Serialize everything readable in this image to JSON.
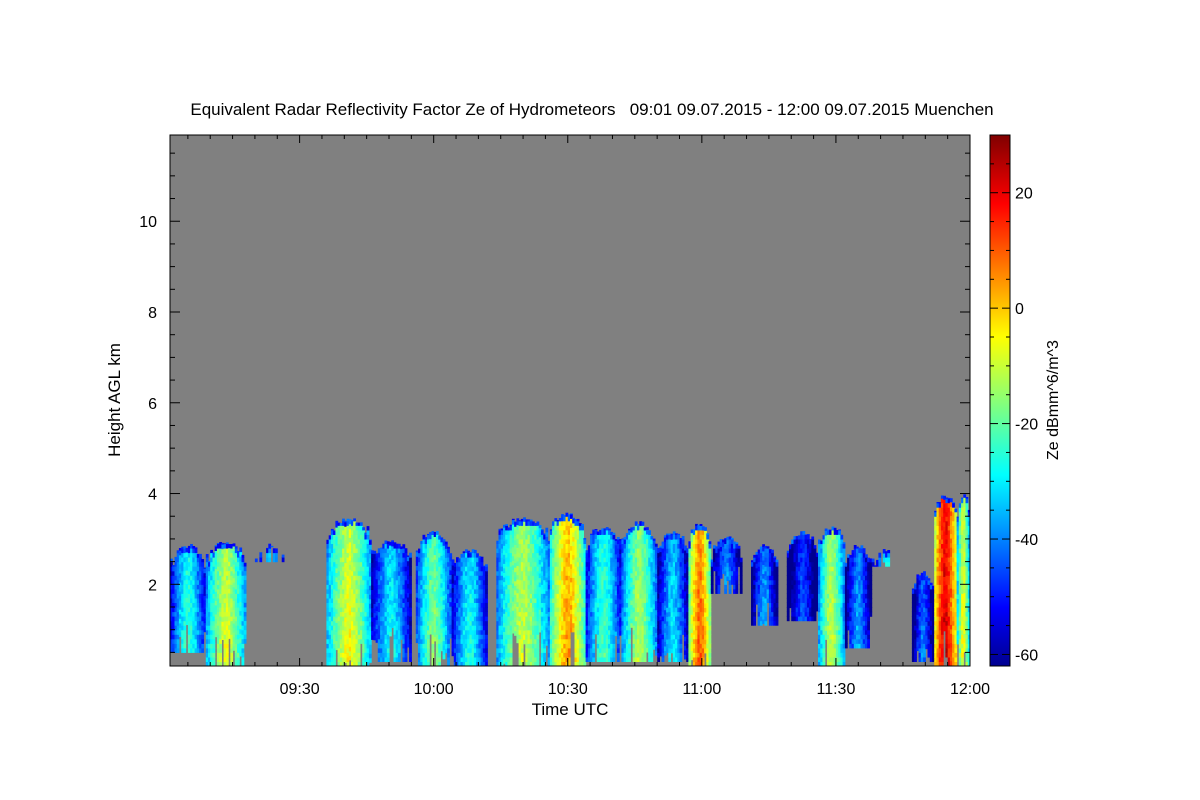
{
  "chart_data": {
    "type": "heatmap",
    "title": "Equivalent Radar Reflectivity Factor Ze of Hydrometeors   09:01 09.07.2015 - 12:00 09.07.2015 Muenchen",
    "xlabel": "Time UTC",
    "ylabel": "Height AGL km",
    "x_tick_labels": [
      "09:30",
      "10:00",
      "10:30",
      "11:00",
      "11:30",
      "12:00"
    ],
    "x_ticks_min": [
      30,
      60,
      90,
      120,
      150,
      180
    ],
    "xlim_min": [
      1,
      180
    ],
    "y_ticks": [
      2,
      4,
      6,
      8,
      10
    ],
    "y_tick_labels": [
      "2",
      "4",
      "6",
      "8",
      "10"
    ],
    "ylim": [
      0.2,
      11.9
    ],
    "background_color": "#808080",
    "colorbar": {
      "label": "Ze dBmm^6/m^3",
      "ticks": [
        20,
        0,
        -20,
        -40,
        -60
      ],
      "tick_labels": [
        "20",
        "0",
        "-20",
        "-40",
        "-60"
      ],
      "range": [
        -62,
        30
      ],
      "colormap": "jet"
    },
    "echo_columns": [
      {
        "t_start": 1,
        "t_end": 9,
        "top_km": 2.9,
        "base_km": 0.5,
        "max_ze": -18
      },
      {
        "t_start": 9,
        "t_end": 18,
        "top_km": 3.0,
        "base_km": 0.2,
        "max_ze": -2
      },
      {
        "t_start": 20,
        "t_end": 27,
        "top_km": 2.9,
        "base_km": 2.5,
        "max_ze": -28
      },
      {
        "t_start": 36,
        "t_end": 46,
        "top_km": 3.5,
        "base_km": 0.2,
        "max_ze": 0
      },
      {
        "t_start": 46,
        "t_end": 55,
        "top_km": 3.0,
        "base_km": 0.3,
        "max_ze": -22
      },
      {
        "t_start": 56,
        "t_end": 64,
        "top_km": 3.2,
        "base_km": 0.2,
        "max_ze": -10
      },
      {
        "t_start": 64,
        "t_end": 72,
        "top_km": 2.8,
        "base_km": 0.2,
        "max_ze": -20
      },
      {
        "t_start": 74,
        "t_end": 86,
        "top_km": 3.5,
        "base_km": 0.2,
        "max_ze": -4
      },
      {
        "t_start": 86,
        "t_end": 94,
        "top_km": 3.6,
        "base_km": 0.2,
        "max_ze": 10
      },
      {
        "t_start": 94,
        "t_end": 102,
        "top_km": 3.3,
        "base_km": 0.3,
        "max_ze": -16
      },
      {
        "t_start": 102,
        "t_end": 110,
        "top_km": 3.4,
        "base_km": 0.3,
        "max_ze": -6
      },
      {
        "t_start": 110,
        "t_end": 117,
        "top_km": 3.2,
        "base_km": 0.3,
        "max_ze": -24
      },
      {
        "t_start": 117,
        "t_end": 122,
        "top_km": 3.4,
        "base_km": 0.2,
        "max_ze": 16
      },
      {
        "t_start": 122,
        "t_end": 129,
        "top_km": 3.1,
        "base_km": 1.8,
        "max_ze": -32
      },
      {
        "t_start": 131,
        "t_end": 137,
        "top_km": 2.9,
        "base_km": 1.1,
        "max_ze": -30
      },
      {
        "t_start": 139,
        "t_end": 146,
        "top_km": 3.2,
        "base_km": 1.2,
        "max_ze": -38
      },
      {
        "t_start": 146,
        "t_end": 152,
        "top_km": 3.3,
        "base_km": 0.2,
        "max_ze": -4
      },
      {
        "t_start": 152,
        "t_end": 158,
        "top_km": 2.9,
        "base_km": 0.6,
        "max_ze": -30
      },
      {
        "t_start": 158,
        "t_end": 164,
        "top_km": 2.8,
        "base_km": 2.4,
        "max_ze": -22
      },
      {
        "t_start": 167,
        "t_end": 172,
        "top_km": 2.3,
        "base_km": 0.3,
        "max_ze": -34
      },
      {
        "t_start": 172,
        "t_end": 177,
        "top_km": 4.0,
        "base_km": 0.2,
        "max_ze": 28
      },
      {
        "t_start": 177,
        "t_end": 180,
        "top_km": 4.0,
        "base_km": 0.2,
        "max_ze": 0
      }
    ]
  }
}
